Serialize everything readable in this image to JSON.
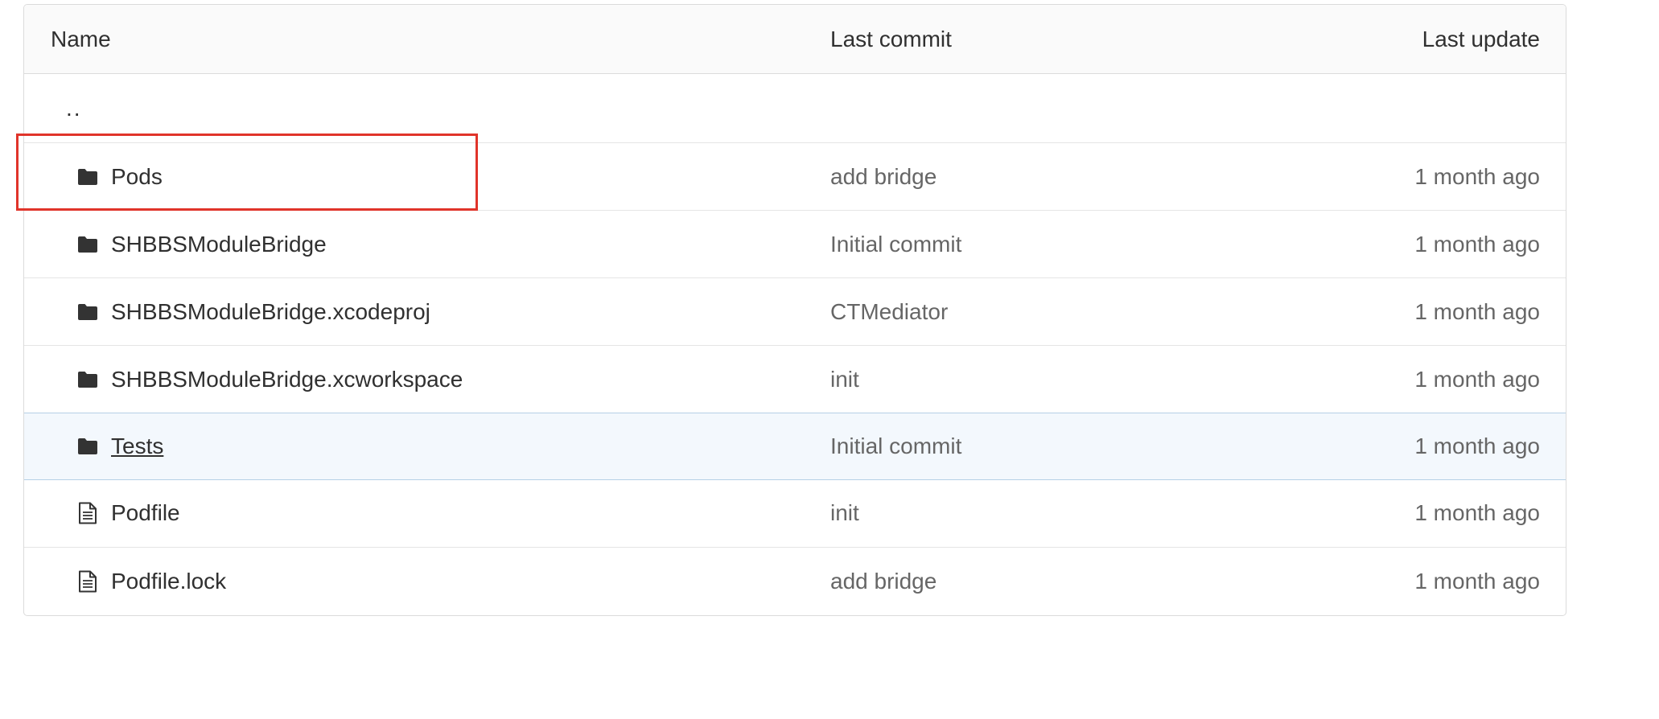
{
  "header": {
    "name": "Name",
    "last_commit": "Last commit",
    "last_update": "Last update"
  },
  "parent_link": "..",
  "rows": [
    {
      "name": "Pods",
      "type": "folder",
      "icon": "folder-icon",
      "commit": "add bridge",
      "updated": "1 month ago"
    },
    {
      "name": "SHBBSModuleBridge",
      "type": "folder",
      "icon": "folder-icon",
      "commit": "Initial commit",
      "updated": "1 month ago"
    },
    {
      "name": "SHBBSModuleBridge.xcodeproj",
      "type": "folder",
      "icon": "folder-icon",
      "commit": "CTMediator",
      "updated": "1 month ago"
    },
    {
      "name": "SHBBSModuleBridge.xcworkspace",
      "type": "folder",
      "icon": "folder-icon",
      "commit": "init",
      "updated": "1 month ago"
    },
    {
      "name": "Tests",
      "type": "folder",
      "icon": "folder-icon",
      "commit": "Initial commit",
      "updated": "1 month ago"
    },
    {
      "name": "Podfile",
      "type": "file",
      "icon": "file-icon",
      "commit": "init",
      "updated": "1 month ago"
    },
    {
      "name": "Podfile.lock",
      "type": "file",
      "icon": "file-icon",
      "commit": "add bridge",
      "updated": "1 month ago"
    }
  ],
  "colors": {
    "highlight_box": "#e0342a",
    "hover_row_bg": "#f3f8fd",
    "hover_row_border": "#b5d0e6"
  }
}
